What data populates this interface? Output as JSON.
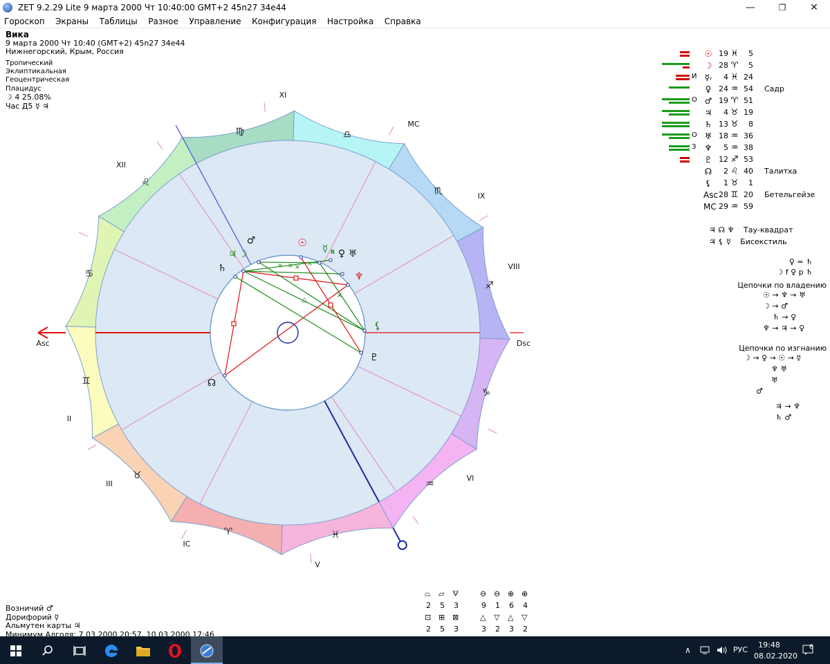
{
  "window": {
    "title": "ZET 9.2.29 Lite    9 марта 2000   Чт   10:40:00 GMT+2 45n27  34e44",
    "min_label": "—",
    "max_label": "❐",
    "close_label": "✕"
  },
  "menu": [
    "Гороскоп",
    "Экраны",
    "Таблицы",
    "Разное",
    "Управление",
    "Конфигурация",
    "Настройка",
    "Справка"
  ],
  "info": {
    "name": "Вика",
    "date_line": "9 марта 2000  Чт  10:40 (GMT+2) 45n27  34e44",
    "place": "Нижнегорский, Крым, Россия",
    "lines": [
      "Тропический",
      "Эклиптикальная",
      "Геоцентрическая",
      "Плацидус"
    ],
    "moon_line": "☽  4 25.08%",
    "hour_line": "Час Д5 ☿ ♃"
  },
  "chart_labels": {
    "houses": [
      "XI",
      "MC",
      "IX",
      "VIII",
      "Dsc",
      "VI",
      "V",
      "IC",
      "III",
      "II",
      "Asc",
      "XII"
    ],
    "signs": [
      "♈",
      "♉",
      "♊",
      "♋",
      "♌",
      "♍",
      "♎",
      "♏",
      "♐",
      "♑",
      "♒",
      "♓"
    ],
    "planet_glyphs": {
      "mars": "♂",
      "jupiter": "♃",
      "moon": "☽",
      "sun": "☉",
      "mercury": "☿",
      "mercury_r": "R",
      "venus": "♀",
      "uranus": "♅",
      "saturn": "♄",
      "neptune": "♆",
      "lilith": "⚸",
      "pluto": "♇",
      "node": "☊"
    },
    "aspect_letters": [
      "×",
      "×",
      "×",
      "×",
      "△",
      "×"
    ]
  },
  "planets": [
    {
      "glyph": "☉",
      "deg": "19",
      "sign": "♓",
      "min": "5",
      "color": "#d00000",
      "bars": [
        {
          "c": "#d00000",
          "w": 14
        },
        {
          "c": "#d00000",
          "w": 14
        }
      ],
      "pre": "",
      "star": ""
    },
    {
      "glyph": "☽",
      "deg": "28",
      "sign": "♈",
      "min": "5",
      "color": "#d00000",
      "bars": [
        {
          "c": "#1a9a1a",
          "w": 40
        },
        {
          "c": "#d00000",
          "w": 10
        }
      ],
      "pre": "",
      "star": ""
    },
    {
      "glyph": "☿ᵣ",
      "deg": "4",
      "sign": "♓",
      "min": "24",
      "color": "#000",
      "bars": [
        {
          "c": "#d00000",
          "w": 20
        },
        {
          "c": "#d00000",
          "w": 20
        }
      ],
      "pre": "И",
      "star": ""
    },
    {
      "glyph": "♀",
      "deg": "24",
      "sign": "♒",
      "min": "54",
      "color": "#000",
      "bars": [
        {
          "c": "#1a9a1a",
          "w": 30
        }
      ],
      "pre": "",
      "star": "Садр"
    },
    {
      "glyph": "♂",
      "deg": "19",
      "sign": "♈",
      "min": "51",
      "color": "#000",
      "bars": [
        {
          "c": "#1a9a1a",
          "w": 40
        },
        {
          "c": "#1a9a1a",
          "w": 30
        }
      ],
      "pre": "О",
      "star": ""
    },
    {
      "glyph": "♃",
      "deg": "4",
      "sign": "♉",
      "min": "19",
      "color": "#000",
      "bars": [
        {
          "c": "#1a9a1a",
          "w": 40
        },
        {
          "c": "#1a9a1a",
          "w": 30
        }
      ],
      "pre": "",
      "star": ""
    },
    {
      "glyph": "♄",
      "deg": "13",
      "sign": "♉",
      "min": "8",
      "color": "#000",
      "bars": [
        {
          "c": "#1a9a1a",
          "w": 40
        },
        {
          "c": "#1a9a1a",
          "w": 40
        }
      ],
      "pre": "",
      "star": ""
    },
    {
      "glyph": "♅",
      "deg": "18",
      "sign": "♒",
      "min": "36",
      "color": "#000",
      "bars": [
        {
          "c": "#1a9a1a",
          "w": 40
        },
        {
          "c": "#1a9a1a",
          "w": 30
        }
      ],
      "pre": "О",
      "star": ""
    },
    {
      "glyph": "♆",
      "deg": "5",
      "sign": "♒",
      "min": "38",
      "color": "#000",
      "bars": [
        {
          "c": "#1a9a1a",
          "w": 30
        },
        {
          "c": "#1a9a1a",
          "w": 30
        }
      ],
      "pre": "З",
      "star": ""
    },
    {
      "glyph": "♇",
      "deg": "12",
      "sign": "♐",
      "min": "53",
      "color": "#000",
      "bars": [
        {
          "c": "#d00000",
          "w": 14
        },
        {
          "c": "#d00000",
          "w": 14
        }
      ],
      "pre": "",
      "star": ""
    },
    {
      "glyph": "☊",
      "deg": "2",
      "sign": "♌",
      "min": "40",
      "color": "#000",
      "bars": [],
      "pre": "",
      "star": "Талитха"
    },
    {
      "glyph": "⚸",
      "deg": "1",
      "sign": "♉",
      "min": "1",
      "color": "#000",
      "bars": [],
      "pre": "",
      "star": ""
    },
    {
      "glyph": "Asc",
      "deg": "28",
      "sign": "♊",
      "min": "20",
      "color": "#000",
      "bars": [],
      "pre": "",
      "star": "Бетельгейзе"
    },
    {
      "glyph": "MC",
      "deg": "29",
      "sign": "♒",
      "min": "59",
      "color": "#000",
      "bars": [],
      "pre": "",
      "star": ""
    }
  ],
  "aspect_figures": [
    {
      "glyphs": "♃ ☊ ♆",
      "label": "Тау-квадрат"
    },
    {
      "glyphs": "♃ ⚸ ☿",
      "label": "Бисекстиль"
    }
  ],
  "right_panel": {
    "line1": "♀ = ♄",
    "line2": "☽ f ♀ p ♄",
    "chains_rule_title": "Цепочки по владению",
    "chains_rule": [
      "☉ → ♆ → ♅",
      "☽ → ♂",
      "♄ → ♀",
      "♆ → ♃ → ♀"
    ],
    "chains_exile_title": "Цепочки по изгнанию",
    "chains_exile": [
      "☽ → ♀ → ☉ → ☿",
      "♆ ♅",
      "♅",
      "♂",
      "♃ → ♆",
      "♄ ♂"
    ]
  },
  "bottom": {
    "lines": [
      "Возничий  ♂",
      "Дорифорий  ☿",
      "Альмутен карты  ♃",
      "Минимум Алголя: 7.03.2000 20:57,  10.03.2000 17:46"
    ]
  },
  "sym_table": {
    "row1_icons": [
      "⏢",
      "▱",
      "⛛",
      "⊖",
      "⊖",
      "⊕",
      "⊕"
    ],
    "row1_values": [
      "2",
      "5",
      "3",
      "9",
      "1",
      "6",
      "4"
    ],
    "row2_icons": [
      "⊡",
      "⊞",
      "⊠",
      "△",
      "▽",
      "△",
      "▽"
    ],
    "row2_values": [
      "2",
      "5",
      "3",
      "3",
      "2",
      "3",
      "2"
    ]
  },
  "taskbar": {
    "lang": "РУС",
    "time": "19:48",
    "date": "08.02.2020",
    "notif": "6",
    "up_arrow": "∧"
  },
  "colors": {
    "aries": "#f4b0b0",
    "taurus": "#f9d3b4",
    "gemini": "#fcfcbe",
    "cancer": "#e0f5b4",
    "leo": "#c3f0c3",
    "virgo": "#a8dcc3",
    "libra": "#b6f5f5",
    "scorpio": "#b6d9f5",
    "sagittarius": "#b7b4f3",
    "capricorn": "#d7b4f3",
    "aquarius": "#f4b4f3",
    "pisces": "#f5b4db",
    "house_bg": "#dde8f5"
  }
}
